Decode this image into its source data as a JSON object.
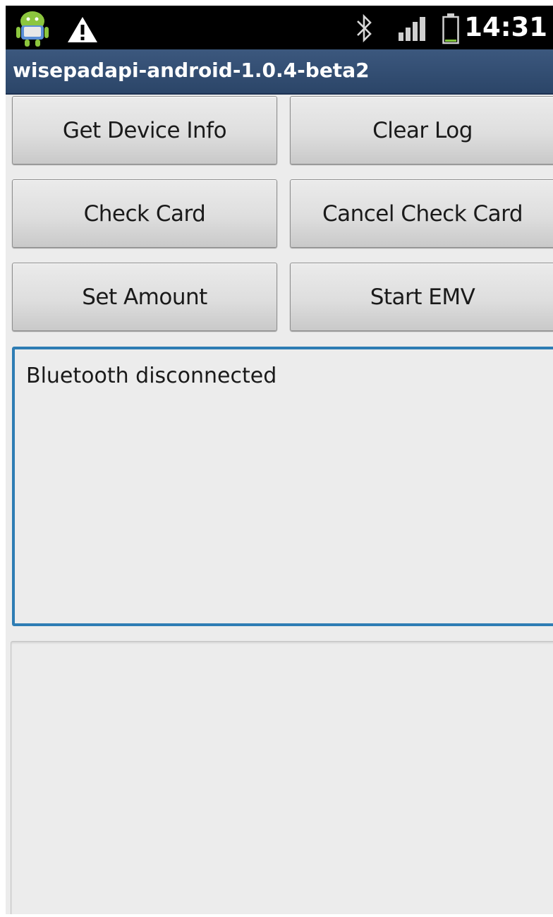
{
  "status_bar": {
    "time": "14:31",
    "icons": [
      "android-notification-icon",
      "warning-icon",
      "bluetooth-icon",
      "signal-icon",
      "battery-icon"
    ]
  },
  "title_bar": {
    "title": "wisepadapi-android-1.0.4-beta2"
  },
  "buttons": {
    "get_device_info": "Get Device Info",
    "clear_log": "Clear Log",
    "check_card": "Check Card",
    "cancel_check_card": "Cancel Check Card",
    "set_amount": "Set Amount",
    "start_emv": "Start EMV"
  },
  "status_log": {
    "text": "Bluetooth disconnected"
  },
  "output_box": {
    "text": ""
  },
  "colors": {
    "status_bar_bg": "#000000",
    "title_bar_bg": "#34507a",
    "focused_border": "#2e7db4",
    "screen_bg": "#ececec"
  }
}
